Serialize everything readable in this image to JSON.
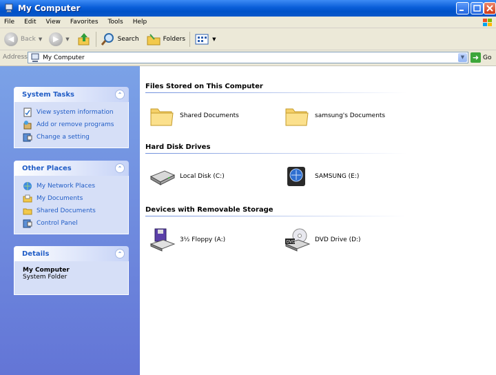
{
  "window": {
    "title": "My Computer"
  },
  "menu": [
    "File",
    "Edit",
    "View",
    "Favorites",
    "Tools",
    "Help"
  ],
  "toolbar": {
    "back": "Back",
    "search": "Search",
    "folders": "Folders"
  },
  "address": {
    "label": "Address",
    "value": "My Computer",
    "go": "Go"
  },
  "taskpane": {
    "system_tasks": {
      "title": "System Tasks",
      "items": [
        "View system information",
        "Add or remove programs",
        "Change a setting"
      ]
    },
    "other_places": {
      "title": "Other Places",
      "items": [
        "My Network Places",
        "My Documents",
        "Shared Documents",
        "Control Panel"
      ]
    },
    "details": {
      "title": "Details",
      "name": "My Computer",
      "type": "System Folder"
    }
  },
  "sections": {
    "files": {
      "title": "Files Stored on This Computer",
      "items": [
        "Shared Documents",
        "samsung's Documents"
      ]
    },
    "drives": {
      "title": "Hard Disk Drives",
      "items": [
        "Local Disk (C:)",
        "SAMSUNG (E:)"
      ]
    },
    "removable": {
      "title": "Devices with Removable Storage",
      "items": [
        "3½ Floppy (A:)",
        "DVD Drive (D:)"
      ]
    }
  }
}
